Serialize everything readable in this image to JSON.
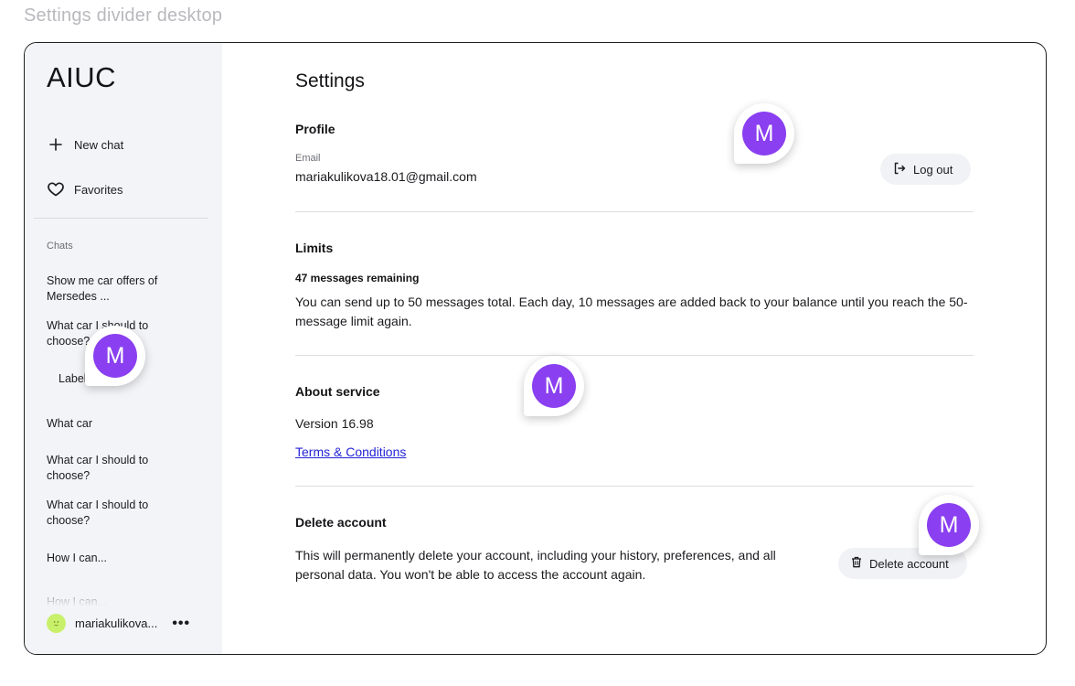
{
  "frame_title": "Settings divider desktop",
  "sidebar": {
    "brand": "AIUC",
    "new_chat": "New chat",
    "favorites": "Favorites",
    "chats_heading": "Chats",
    "chats": [
      "Show me car offers of Mersedes ...",
      "What car I should to choose?",
      "Label",
      "What car",
      "What car I should to choose?",
      "What car I should to choose?",
      "How I can...",
      "How I can..."
    ],
    "user": {
      "name": "mariakulikova...",
      "more": "•••"
    }
  },
  "settings": {
    "title": "Settings",
    "profile": {
      "title": "Profile",
      "email_label": "Email",
      "email": "mariakulikova18.01@gmail.com",
      "logout": "Log out"
    },
    "limits": {
      "title": "Limits",
      "remaining": "47 messages remaining",
      "description": "You can send up to 50 messages total. Each day, 10 messages are added back to your balance until you reach the 50-message limit again."
    },
    "about": {
      "title": "About service",
      "version": "Version 16.98",
      "terms": "Terms & Conditions"
    },
    "delete": {
      "title": "Delete account",
      "description": "This will permanently delete your account, including your history, preferences, and all personal data. You won't be able to access the account again.",
      "button": "Delete account"
    }
  },
  "collaborator_avatar_letter": "M",
  "colors": {
    "avatar": "#8a3ff0",
    "link": "#2323d6",
    "sidebar_bg": "#f3f4f7"
  }
}
